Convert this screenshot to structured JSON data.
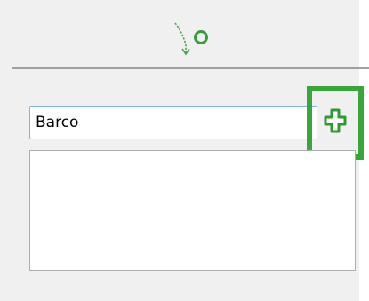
{
  "header": {
    "icon": "branch-arrow-icon"
  },
  "form": {
    "name_value": "Barco",
    "add_icon": "plus-icon"
  },
  "list": {
    "items": []
  },
  "colors": {
    "background": "#f0f0f0",
    "icon_green": "#4aa84a",
    "highlight_green": "#3aa53a",
    "input_border_focus": "#7eb4ea",
    "list_border": "#adadad",
    "divider": "#a0a0a0"
  }
}
